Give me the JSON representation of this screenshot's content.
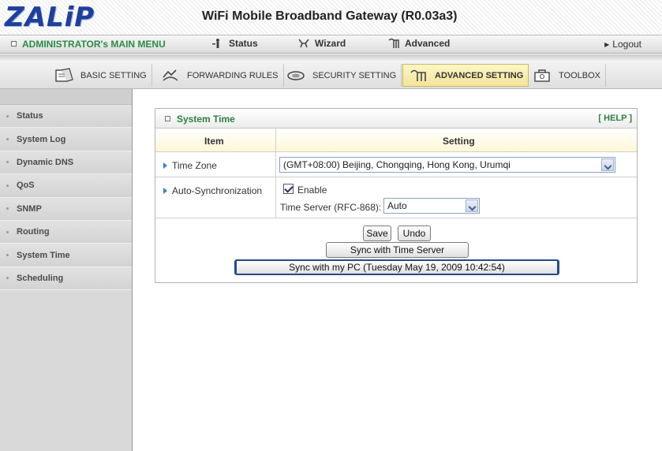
{
  "header": {
    "logo_text": "ZALiP",
    "title": "WiFi Mobile Broadband Gateway (R0.03a3)"
  },
  "main_menu": {
    "admin_label": "ADMINISTRATOR's MAIN MENU",
    "items": [
      {
        "label": "Status",
        "icon": "status-person-icon"
      },
      {
        "label": "Wizard",
        "icon": "wizard-icon"
      },
      {
        "label": "Advanced",
        "icon": "advanced-icon"
      }
    ],
    "logout_label": "Logout"
  },
  "tabs": [
    {
      "label": "BASIC SETTING",
      "icon": "basic-setting-icon",
      "active": false
    },
    {
      "label": "FORWARDING RULES",
      "icon": "forwarding-rules-icon",
      "active": false
    },
    {
      "label": "SECURITY SETTING",
      "icon": "security-setting-icon",
      "active": false
    },
    {
      "label": "ADVANCED SETTING",
      "icon": "advanced-setting-icon",
      "active": true
    },
    {
      "label": "TOOLBOX",
      "icon": "toolbox-icon",
      "active": false
    }
  ],
  "sidebar": {
    "items": [
      {
        "label": "Status"
      },
      {
        "label": "System Log"
      },
      {
        "label": "Dynamic DNS"
      },
      {
        "label": "QoS"
      },
      {
        "label": "SNMP"
      },
      {
        "label": "Routing"
      },
      {
        "label": "System Time"
      },
      {
        "label": "Scheduling"
      }
    ]
  },
  "panel": {
    "title": "System Time",
    "help_label": "[ HELP ]",
    "columns": {
      "item": "Item",
      "setting": "Setting"
    },
    "time_zone": {
      "label": "Time Zone",
      "value": "(GMT+08:00) Beijing, Chongqing, Hong Kong, Urumqi"
    },
    "auto_sync": {
      "label": "Auto-Synchronization",
      "enable_label": "Enable",
      "enabled": true,
      "time_server_label": "Time Server (RFC-868):",
      "time_server_value": "Auto"
    },
    "buttons": {
      "save": "Save",
      "undo": "Undo",
      "sync_server": "Sync with Time Server",
      "sync_pc": "Sync with my PC (Tuesday May 19, 2009 10:42:54)"
    }
  },
  "colors": {
    "accent_green": "#2b8a46",
    "logo_blue": "#1f3f9e",
    "active_tab": "#f2e49a"
  }
}
